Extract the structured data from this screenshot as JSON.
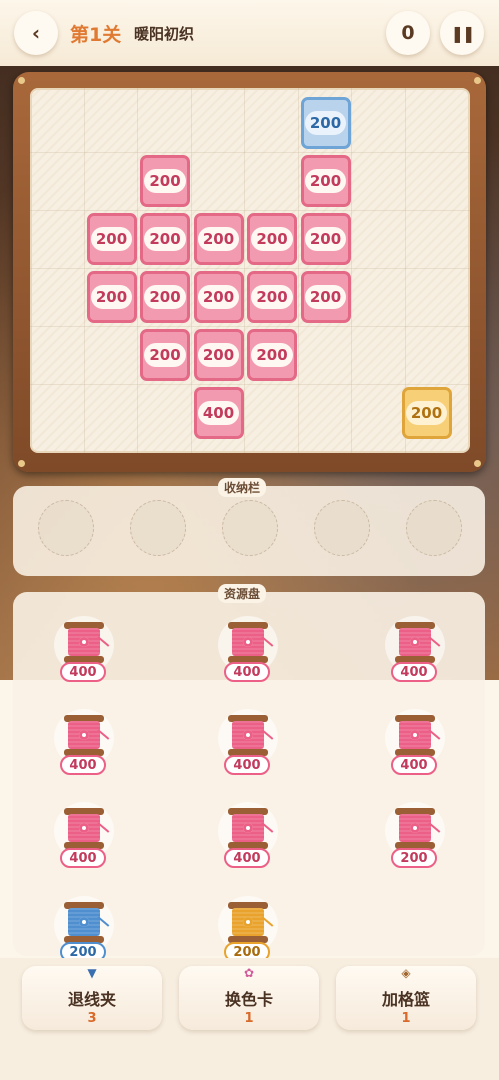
{
  "header": {
    "back_icon": "chevron-left-icon",
    "level": "第1关",
    "level_name": "暖阳初织",
    "score": "0",
    "pause_icon": "pause-icon"
  },
  "board": {
    "rows": 6,
    "cols": 8,
    "tiles": [
      {
        "row": 0,
        "col": 5,
        "color": "blue",
        "value": "200"
      },
      {
        "row": 1,
        "col": 2,
        "color": "pink",
        "value": "200"
      },
      {
        "row": 1,
        "col": 5,
        "color": "pink",
        "value": "200"
      },
      {
        "row": 2,
        "col": 1,
        "color": "pink",
        "value": "200"
      },
      {
        "row": 2,
        "col": 2,
        "color": "pink",
        "value": "200"
      },
      {
        "row": 2,
        "col": 3,
        "color": "pink",
        "value": "200"
      },
      {
        "row": 2,
        "col": 4,
        "color": "pink",
        "value": "200"
      },
      {
        "row": 2,
        "col": 5,
        "color": "pink",
        "value": "200"
      },
      {
        "row": 3,
        "col": 1,
        "color": "pink",
        "value": "200"
      },
      {
        "row": 3,
        "col": 2,
        "color": "pink",
        "value": "200"
      },
      {
        "row": 3,
        "col": 3,
        "color": "pink",
        "value": "200"
      },
      {
        "row": 3,
        "col": 4,
        "color": "pink",
        "value": "200"
      },
      {
        "row": 3,
        "col": 5,
        "color": "pink",
        "value": "200"
      },
      {
        "row": 4,
        "col": 2,
        "color": "pink",
        "value": "200"
      },
      {
        "row": 4,
        "col": 3,
        "color": "pink",
        "value": "200"
      },
      {
        "row": 4,
        "col": 4,
        "color": "pink",
        "value": "200"
      },
      {
        "row": 5,
        "col": 3,
        "color": "pink",
        "value": "400"
      },
      {
        "row": 5,
        "col": 7,
        "color": "gold",
        "value": "200"
      }
    ]
  },
  "storage": {
    "label": "收纳栏",
    "slot_count": 5
  },
  "resource": {
    "label": "资源盘",
    "spools": [
      {
        "row": 0,
        "col": 0,
        "color": "pink",
        "value": "400"
      },
      {
        "row": 0,
        "col": 1,
        "color": "pink",
        "value": "400"
      },
      {
        "row": 0,
        "col": 2,
        "color": "pink",
        "value": "400"
      },
      {
        "row": 1,
        "col": 0,
        "color": "pink",
        "value": "400"
      },
      {
        "row": 1,
        "col": 1,
        "color": "pink",
        "value": "400"
      },
      {
        "row": 1,
        "col": 2,
        "color": "pink",
        "value": "400"
      },
      {
        "row": 2,
        "col": 0,
        "color": "pink",
        "value": "400"
      },
      {
        "row": 2,
        "col": 1,
        "color": "pink",
        "value": "400"
      },
      {
        "row": 2,
        "col": 2,
        "color": "pink",
        "value": "200"
      },
      {
        "row": 3,
        "col": 0,
        "color": "blue",
        "value": "200"
      },
      {
        "row": 3,
        "col": 1,
        "color": "gold",
        "value": "200"
      }
    ]
  },
  "colors": {
    "pink": "#ec5f86",
    "pink_text": "#c23a5c",
    "blue": "#4f8fd0",
    "blue_text": "#2c69a6",
    "gold": "#e9a32c",
    "gold_text": "#a86a0c"
  },
  "tools": [
    {
      "label": "退线夹",
      "count": "3",
      "icon": "thread-clip-icon"
    },
    {
      "label": "换色卡",
      "count": "1",
      "icon": "color-card-icon"
    },
    {
      "label": "加格篮",
      "count": "1",
      "icon": "basket-icon"
    }
  ]
}
